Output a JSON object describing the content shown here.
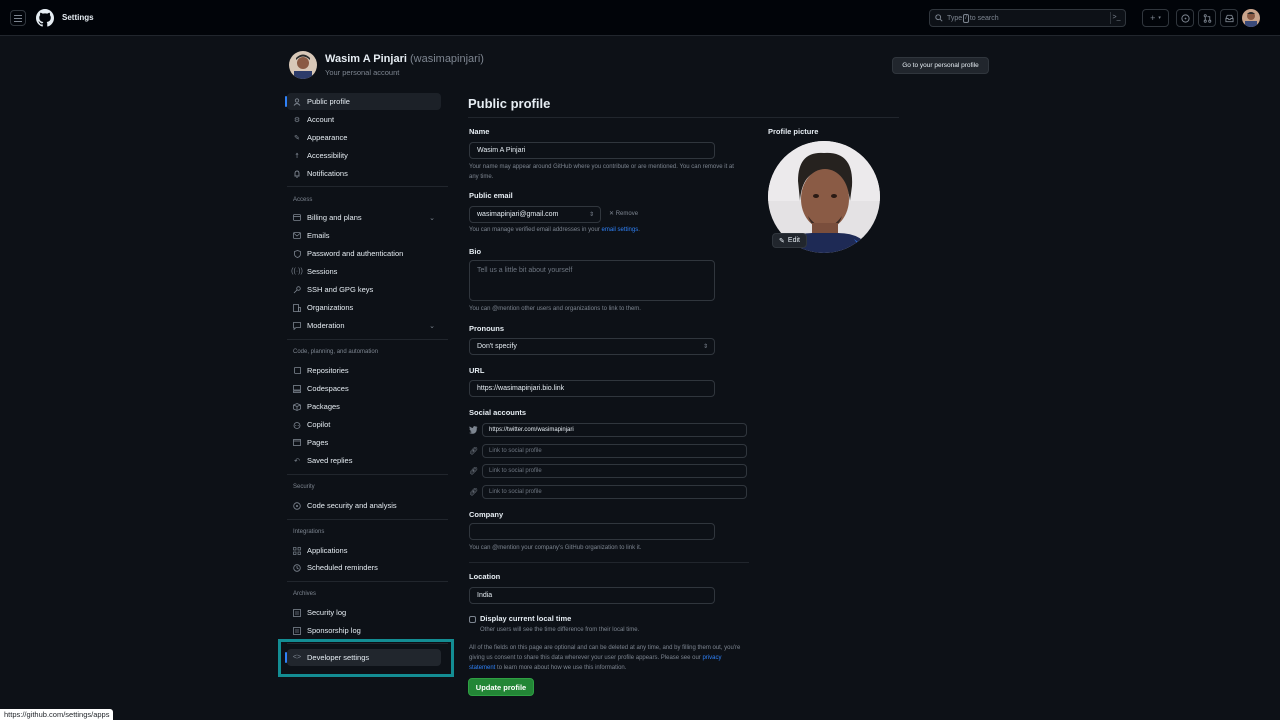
{
  "header": {
    "title": "Settings",
    "search_text_pre": "Type",
    "search_key": "/",
    "search_text_post": "to search",
    "new_symbol": "+"
  },
  "profile_header": {
    "name": "Wasim A Pinjari",
    "handle": "(wasimapinjari)",
    "subtitle": "Your personal account",
    "go_button": "Go to your personal profile"
  },
  "sidebar": {
    "items": [
      {
        "label": "Public profile",
        "icon": "person-icon"
      },
      {
        "label": "Account",
        "icon": "gear-icon"
      },
      {
        "label": "Appearance",
        "icon": "paintbrush-icon"
      },
      {
        "label": "Accessibility",
        "icon": "accessibility-icon"
      },
      {
        "label": "Notifications",
        "icon": "bell-icon"
      }
    ],
    "access_title": "Access",
    "access": [
      {
        "label": "Billing and plans",
        "icon": "credit-card-icon"
      },
      {
        "label": "Emails",
        "icon": "mail-icon"
      },
      {
        "label": "Password and authentication",
        "icon": "shield-lock-icon"
      },
      {
        "label": "Sessions",
        "icon": "broadcast-icon"
      },
      {
        "label": "SSH and GPG keys",
        "icon": "key-icon"
      },
      {
        "label": "Organizations",
        "icon": "organization-icon"
      },
      {
        "label": "Moderation",
        "icon": "report-icon"
      }
    ],
    "code_title": "Code, planning, and automation",
    "code": [
      {
        "label": "Repositories",
        "icon": "repo-icon"
      },
      {
        "label": "Codespaces",
        "icon": "codespaces-icon"
      },
      {
        "label": "Packages",
        "icon": "package-icon"
      },
      {
        "label": "Copilot",
        "icon": "copilot-icon"
      },
      {
        "label": "Pages",
        "icon": "browser-icon"
      },
      {
        "label": "Saved replies",
        "icon": "reply-icon"
      }
    ],
    "security_title": "Security",
    "security": [
      {
        "label": "Code security and analysis",
        "icon": "codescan-icon"
      }
    ],
    "integrations_title": "Integrations",
    "integrations": [
      {
        "label": "Applications",
        "icon": "apps-icon"
      },
      {
        "label": "Scheduled reminders",
        "icon": "clock-icon"
      }
    ],
    "archives_title": "Archives",
    "archives": [
      {
        "label": "Security log",
        "icon": "log-icon"
      },
      {
        "label": "Sponsorship log",
        "icon": "log-icon"
      }
    ],
    "developer": {
      "label": "Developer settings",
      "icon": "code-icon"
    }
  },
  "main": {
    "title": "Public profile",
    "name_label": "Name",
    "name_value": "Wasim A Pinjari",
    "name_note": "Your name may appear around GitHub where you contribute or are mentioned. You can remove it at any time.",
    "email_label": "Public email",
    "email_value": "wasimapinjari@gmail.com",
    "email_remove": "Remove",
    "email_note_pre": "You can manage verified email addresses in your ",
    "email_note_link": "email settings",
    "email_note_post": ".",
    "bio_label": "Bio",
    "bio_placeholder": "Tell us a little bit about yourself",
    "bio_note": "You can @mention other users and organizations to link to them.",
    "pronouns_label": "Pronouns",
    "pronouns_value": "Don't specify",
    "url_label": "URL",
    "url_value": "https://wasimapinjari.bio.link",
    "social_label": "Social accounts",
    "social": [
      {
        "value": "https://twitter.com/wasimapinjari",
        "icon": "twitter-icon"
      },
      {
        "value": "Link to social profile",
        "icon": "link-icon"
      },
      {
        "value": "Link to social profile",
        "icon": "link-icon"
      },
      {
        "value": "Link to social profile",
        "icon": "link-icon"
      }
    ],
    "company_label": "Company",
    "company_value": "",
    "company_note": "You can @mention your company's GitHub organization to link it.",
    "location_label": "Location",
    "location_value": "India",
    "local_time_label": "Display current local time",
    "local_time_note": "Other users will see the time difference from their local time.",
    "footer_note_pre": "All of the fields on this page are optional and can be deleted at any time, and by filling them out, you're giving us consent to share this data wherever your user profile appears. Please see our ",
    "footer_note_link": "privacy statement",
    "footer_note_post": " to learn more about how we use this information.",
    "update_button": "Update profile",
    "picture_label": "Profile picture",
    "edit_button": "Edit"
  },
  "status_bar": {
    "url": "https://github.com/settings/apps"
  },
  "colors": {
    "background": "#0d1117",
    "accent_blue": "#2f81f7",
    "button_green": "#238636",
    "highlight_teal": "#138d93"
  }
}
